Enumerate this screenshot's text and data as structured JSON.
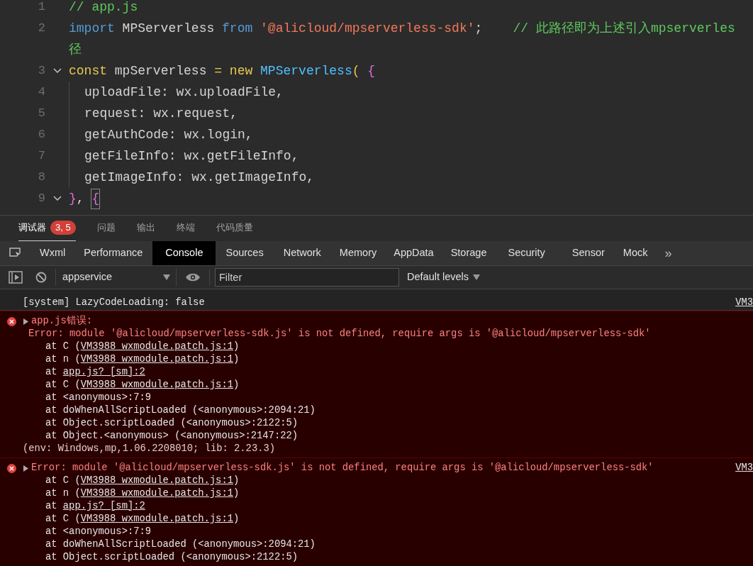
{
  "editor": {
    "lines": [
      {
        "number": "1",
        "fold": false,
        "indented": false,
        "tokens": [
          {
            "text": "// app.js",
            "kind": "comment"
          }
        ]
      },
      {
        "number": "2",
        "fold": false,
        "indented": false,
        "tokens": [
          {
            "text": "import",
            "kind": "keyword"
          },
          {
            "text": " MPServerless ",
            "kind": "plain"
          },
          {
            "text": "from",
            "kind": "keyword"
          },
          {
            "text": " '@alicloud/mpserverless-sdk'",
            "kind": "string"
          },
          {
            "text": ";    ",
            "kind": "plain"
          },
          {
            "text": "// 此路径即为上述引入mpserverles",
            "kind": "comment"
          }
        ],
        "wrap": {
          "text": "径",
          "kind": "comment"
        }
      },
      {
        "number": "3",
        "fold": true,
        "indented": false,
        "tokens": [
          {
            "text": "const",
            "kind": "storage"
          },
          {
            "text": " mpServerless ",
            "kind": "plain"
          },
          {
            "text": "= new",
            "kind": "storage"
          },
          {
            "text": " MPServerless",
            "kind": "class"
          },
          {
            "text": "( ",
            "kind": "storage"
          },
          {
            "text": "{",
            "kind": "bracket"
          }
        ]
      },
      {
        "number": "4",
        "fold": false,
        "indented": true,
        "tokens": [
          {
            "text": "uploadFile: wx.uploadFile,",
            "kind": "plain"
          }
        ]
      },
      {
        "number": "5",
        "fold": false,
        "indented": true,
        "tokens": [
          {
            "text": "request: wx.request,",
            "kind": "plain"
          }
        ]
      },
      {
        "number": "6",
        "fold": false,
        "indented": true,
        "tokens": [
          {
            "text": "getAuthCode: wx.login,",
            "kind": "plain"
          }
        ]
      },
      {
        "number": "7",
        "fold": false,
        "indented": true,
        "tokens": [
          {
            "text": "getFileInfo: wx.getFileInfo,",
            "kind": "plain"
          }
        ]
      },
      {
        "number": "8",
        "fold": false,
        "indented": true,
        "tokens": [
          {
            "text": "getImageInfo: wx.getImageInfo,",
            "kind": "plain"
          }
        ]
      },
      {
        "number": "9",
        "fold": true,
        "indented": false,
        "tokens": [
          {
            "text": "}",
            "kind": "bracket"
          },
          {
            "text": ", ",
            "kind": "plain"
          },
          {
            "text": "{",
            "kind": "bracket-matched"
          }
        ]
      }
    ]
  },
  "panel_tabs": [
    {
      "label": "调试器",
      "selected": true,
      "badge": "3, 5"
    },
    {
      "label": "问题",
      "selected": false
    },
    {
      "label": "输出",
      "selected": false
    },
    {
      "label": "终端",
      "selected": false
    },
    {
      "label": "代码质量",
      "selected": false
    }
  ],
  "devtools_tabs": [
    {
      "label": "Wxml",
      "selected": false
    },
    {
      "label": "Performance",
      "selected": false
    },
    {
      "label": "Console",
      "selected": true
    },
    {
      "label": "Sources",
      "selected": false
    },
    {
      "label": "Network",
      "selected": false
    },
    {
      "label": "Memory",
      "selected": false
    },
    {
      "label": "AppData",
      "selected": false
    },
    {
      "label": "Storage",
      "selected": false
    },
    {
      "label": "Security",
      "selected": false
    },
    {
      "label": "Sensor",
      "selected": false
    },
    {
      "label": "Mock",
      "selected": false
    }
  ],
  "devtools_more": "»",
  "toolbar": {
    "context": "appservice",
    "filter_placeholder": "Filter",
    "levels": "Default levels"
  },
  "console": [
    {
      "kind": "log",
      "text": "[system] LazyCodeLoading: false",
      "source": "VM3"
    },
    {
      "kind": "error",
      "expanded": false,
      "title": "app.js错误:",
      "message": "Error: module '@alicloud/mpserverless-sdk.js' is not defined, require args is '@alicloud/mpserverless-sdk'",
      "frames": [
        {
          "prefix": "at C (",
          "link": "VM3988 wxmodule.patch.js:1",
          "suffix": ")"
        },
        {
          "prefix": "at n (",
          "link": "VM3988 wxmodule.patch.js:1",
          "suffix": ")"
        },
        {
          "prefix": "at ",
          "link": "app.js? [sm]:2"
        },
        {
          "prefix": "at C (",
          "link": "VM3988 wxmodule.patch.js:1",
          "suffix": ")"
        },
        {
          "prefix": "at <anonymous>:7:9"
        },
        {
          "prefix": "at doWhenAllScriptLoaded (<anonymous>:2094:21)"
        },
        {
          "prefix": "at Object.scriptLoaded (<anonymous>:2122:5)"
        },
        {
          "prefix": "at Object.<anonymous> (<anonymous>:2147:22)"
        }
      ],
      "footer": "(env: Windows,mp,1.06.2208010; lib: 2.23.3)"
    },
    {
      "kind": "error",
      "expanded": false,
      "title": "Error: module '@alicloud/mpserverless-sdk.js' is not defined, require args is '@alicloud/mpserverless-sdk'",
      "source": "VM3",
      "frames": [
        {
          "prefix": "at C (",
          "link": "VM3988 wxmodule.patch.js:1",
          "suffix": ")"
        },
        {
          "prefix": "at n (",
          "link": "VM3988 wxmodule.patch.js:1",
          "suffix": ")"
        },
        {
          "prefix": "at ",
          "link": "app.js? [sm]:2"
        },
        {
          "prefix": "at C (",
          "link": "VM3988 wxmodule.patch.js:1",
          "suffix": ")"
        },
        {
          "prefix": "at <anonymous>:7:9"
        },
        {
          "prefix": "at doWhenAllScriptLoaded (<anonymous>:2094:21)"
        },
        {
          "prefix": "at Object.scriptLoaded (<anonymous>:2122:5)"
        }
      ]
    }
  ]
}
